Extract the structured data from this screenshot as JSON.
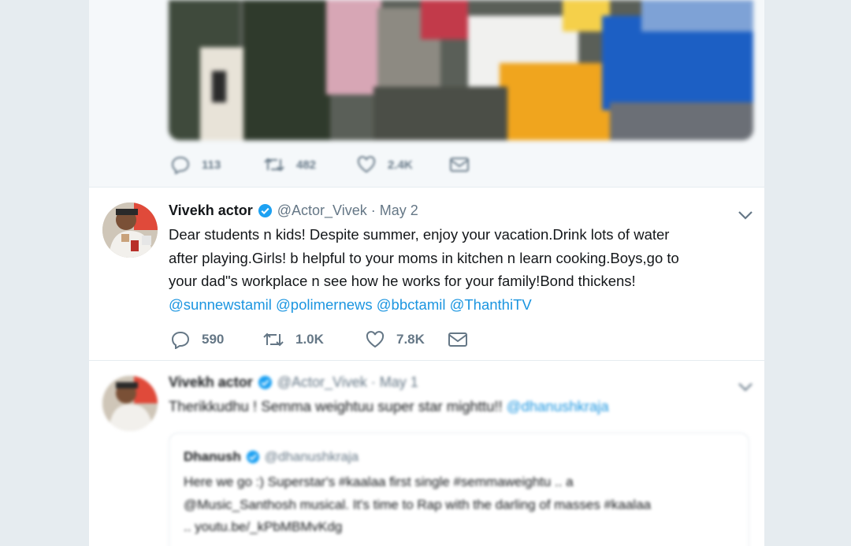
{
  "previous_tweet": {
    "reply_count": "113",
    "retweet_count": "482",
    "like_count": "2.4K"
  },
  "main_tweet": {
    "display_name": "Vivekh actor",
    "handle": "@Actor_Vivek",
    "separator": "·",
    "date": "May 2",
    "text_lines": [
      "Dear students n kids! Despite summer, enjoy your vacation.Drink lots of water",
      "after playing.Girls! b helpful to your moms in kitchen n learn cooking.Boys,go to",
      "your dad\"s workplace n see how he works for your family!Bond thickens!"
    ],
    "mentions": [
      "@sunnewstamil",
      "@polimernews",
      "@bbctamil",
      "@ThanthiTV"
    ],
    "reply_count": "590",
    "retweet_count": "1.0K",
    "like_count": "7.8K"
  },
  "next_tweet": {
    "display_name": "Vivekh actor",
    "handle": "@Actor_Vivek",
    "separator": "·",
    "date": "May 1",
    "text": "Therikkudhu ! Semma weightuu super star mighttu!! ",
    "mention": "@dhanushkraja",
    "quote": {
      "display_name": "Dhanush",
      "handle": "@dhanushkraja",
      "text_lines": [
        "Here we go :) Superstar's #kaalaa first single #semmaweightu .. a",
        "@Music_Santhosh musical. It's time to Rap with the darling of masses #kaalaa",
        ".. youtu.be/_kPbMBMvKdg"
      ]
    }
  },
  "colors": {
    "link": "#1b95e0",
    "secondary_text": "#657786",
    "verified": "#1da1f2",
    "background": "#e6ecf0"
  },
  "icons": [
    "reply-icon",
    "retweet-icon",
    "like-icon",
    "direct-message-icon",
    "verified-badge-icon",
    "chevron-down-icon"
  ]
}
